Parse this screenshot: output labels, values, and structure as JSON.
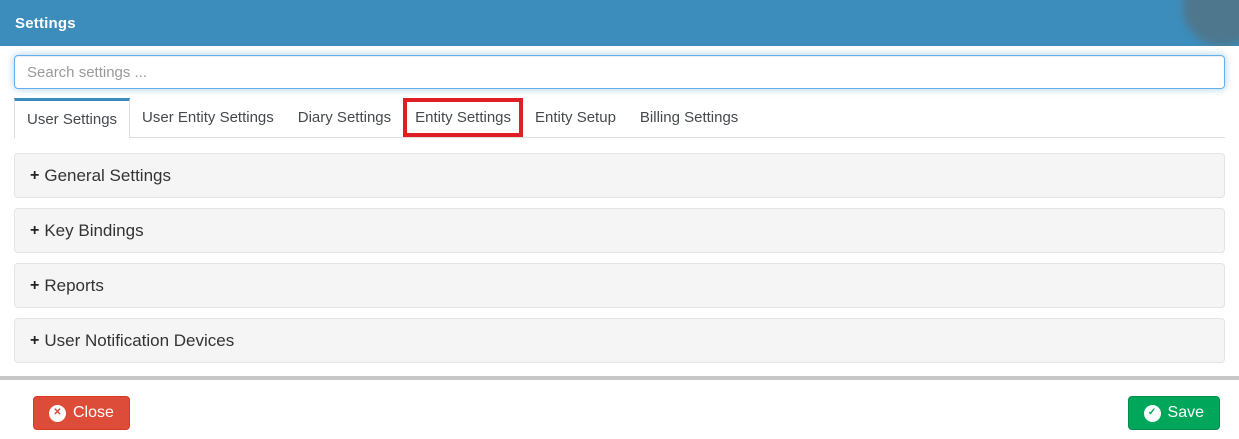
{
  "header": {
    "title": "Settings"
  },
  "search": {
    "placeholder": "Search settings ..."
  },
  "tabs": [
    {
      "label": "User Settings",
      "active": true
    },
    {
      "label": "User Entity Settings",
      "active": false
    },
    {
      "label": "Diary Settings",
      "active": false
    },
    {
      "label": "Entity Settings",
      "active": false,
      "annotated": true
    },
    {
      "label": "Entity Setup",
      "active": false
    },
    {
      "label": "Billing Settings",
      "active": false
    }
  ],
  "panels": [
    {
      "expand_glyph": "+",
      "label": "General Settings"
    },
    {
      "expand_glyph": "+",
      "label": "Key Bindings"
    },
    {
      "expand_glyph": "+",
      "label": "Reports"
    },
    {
      "expand_glyph": "+",
      "label": "User Notification Devices"
    }
  ],
  "footer": {
    "close_label": "Close",
    "close_icon_glyph": "✕",
    "save_label": "Save",
    "save_icon_glyph": "✓"
  },
  "colors": {
    "header_bg": "#3c8dbc",
    "active_tab_accent": "#3c8dbc",
    "annotation_red": "#e01e25",
    "search_focus_border": "#66afe9",
    "panel_bg": "#f5f5f5",
    "close_button_bg": "#dd4b39",
    "save_button_bg": "#00a65a",
    "divider": "#c6c6c6"
  }
}
